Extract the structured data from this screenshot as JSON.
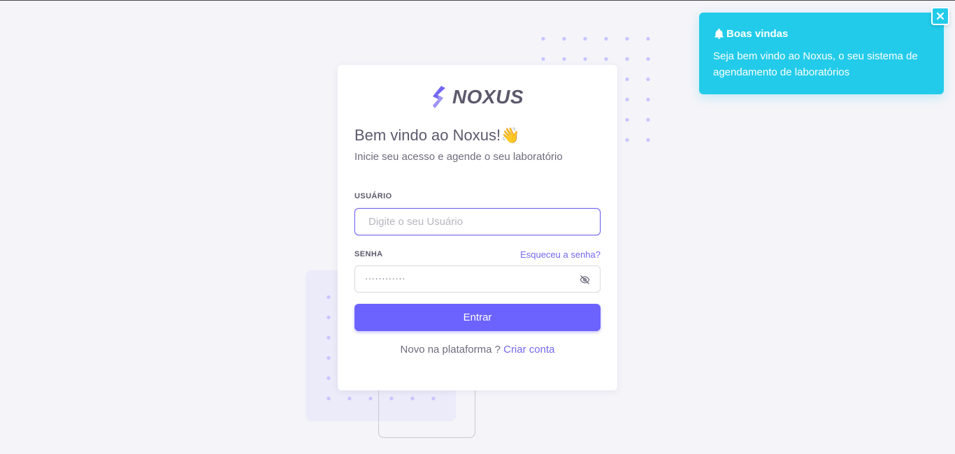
{
  "brand": {
    "name": "NOXUS"
  },
  "login": {
    "title": "Bem vindo ao Noxus!👋",
    "subtitle": "Inicie seu acesso e agende o seu laboratório",
    "user_label": "USUÁRIO",
    "user_placeholder": "Digite o seu Usuário",
    "password_label": "SENHA",
    "forgot_label": "Esqueceu a senha?",
    "password_value": "············",
    "submit_label": "Entrar",
    "signup_prompt": "Novo na plataforma ?",
    "signup_link": "Criar conta"
  },
  "toast": {
    "title": "Boas vindas",
    "message": "Seja bem vindo ao Noxus, o seu sistema de agendamento de laboratórios"
  },
  "colors": {
    "primary": "#7367f0",
    "button": "#6c63ff",
    "toast": "#22cbea",
    "background": "#f4f4f9"
  },
  "icons": {
    "logo": "noxus-bolt-logo",
    "password_toggle": "eye-off-icon",
    "toast": "bell-icon",
    "toast_close": "close-icon"
  }
}
